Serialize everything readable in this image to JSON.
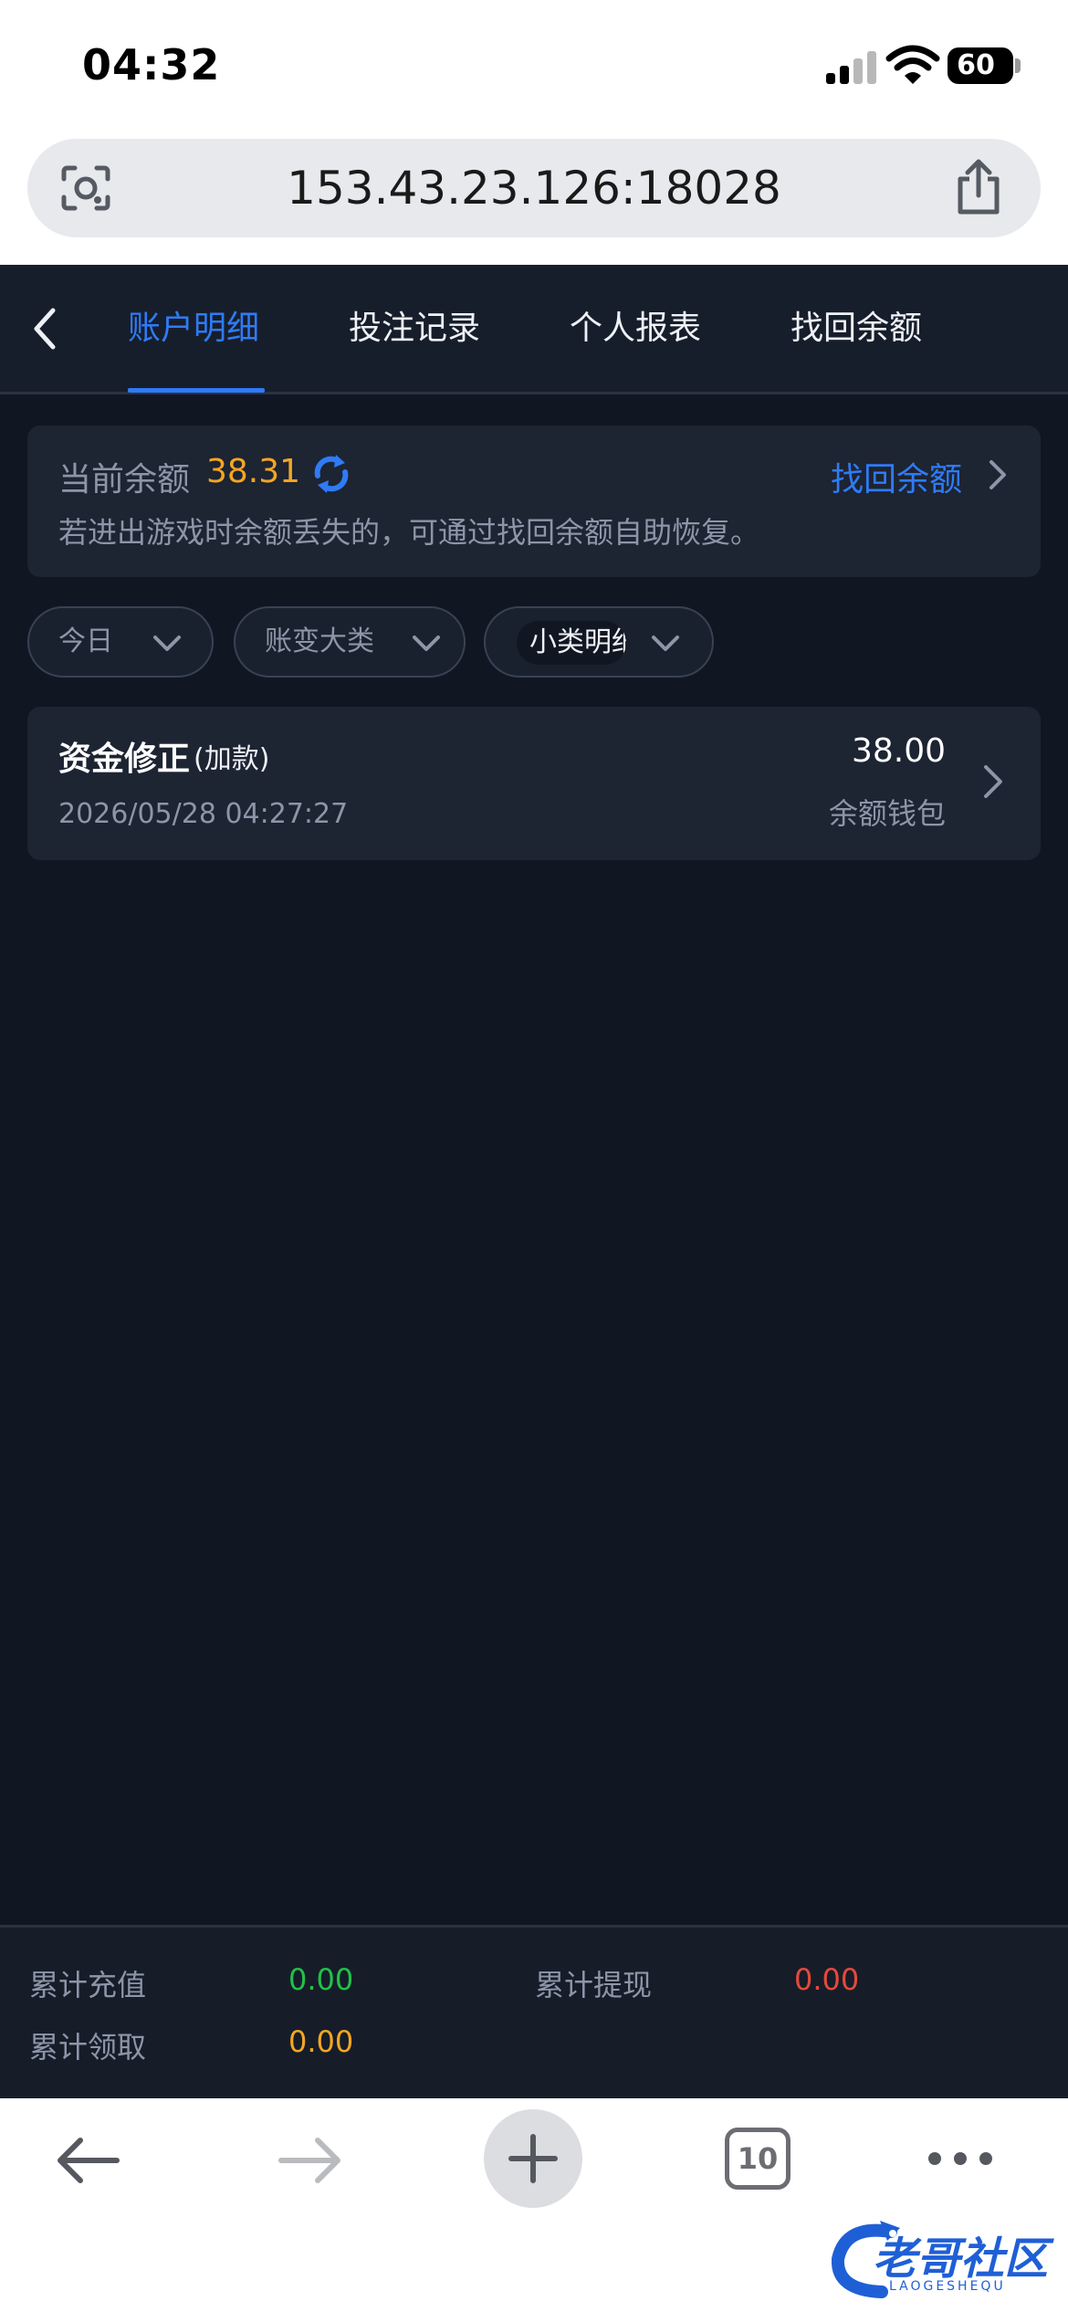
{
  "status_bar": {
    "time": "04:32",
    "battery": "60"
  },
  "browser": {
    "url": "153.43.23.126:18028",
    "tab_count": "10"
  },
  "nav": {
    "tabs": [
      {
        "label": "账户明细",
        "active": true
      },
      {
        "label": "投注记录",
        "active": false
      },
      {
        "label": "个人报表",
        "active": false
      },
      {
        "label": "找回余额",
        "active": false
      }
    ]
  },
  "balance": {
    "label": "当前余额",
    "value": "38.31",
    "recover_label": "找回余额",
    "note": "若进出游戏时余额丢失的，可通过找回余额自助恢复。"
  },
  "filters": [
    {
      "label": "今日"
    },
    {
      "label": "账变大类"
    },
    {
      "label": "小类明细"
    }
  ],
  "records": [
    {
      "title": "资金修正",
      "subtitle": "(加款)",
      "time": "2026/05/28 04:27:27",
      "amount": "38.00",
      "wallet": "余额钱包"
    }
  ],
  "summary": {
    "recharge_label": "累计充值",
    "recharge_value": "0.00",
    "withdraw_label": "累计提现",
    "withdraw_value": "0.00",
    "claim_label": "累计领取",
    "claim_value": "0.00"
  },
  "watermark": {
    "text": "老哥社区",
    "sub": "LAOGESHEQU"
  },
  "colors": {
    "accent": "#2f7bf6",
    "balance": "#f4a622",
    "recharge": "#22c04a",
    "withdraw": "#e24a3b",
    "claim": "#f4a622"
  },
  "icons": [
    "camera-lens-icon",
    "share-icon",
    "back-chevron-icon",
    "refresh-icon",
    "chevron-right-icon",
    "chevron-down-icon",
    "arrow-left-icon",
    "arrow-right-icon",
    "plus-icon",
    "tabs-icon",
    "more-icon"
  ]
}
